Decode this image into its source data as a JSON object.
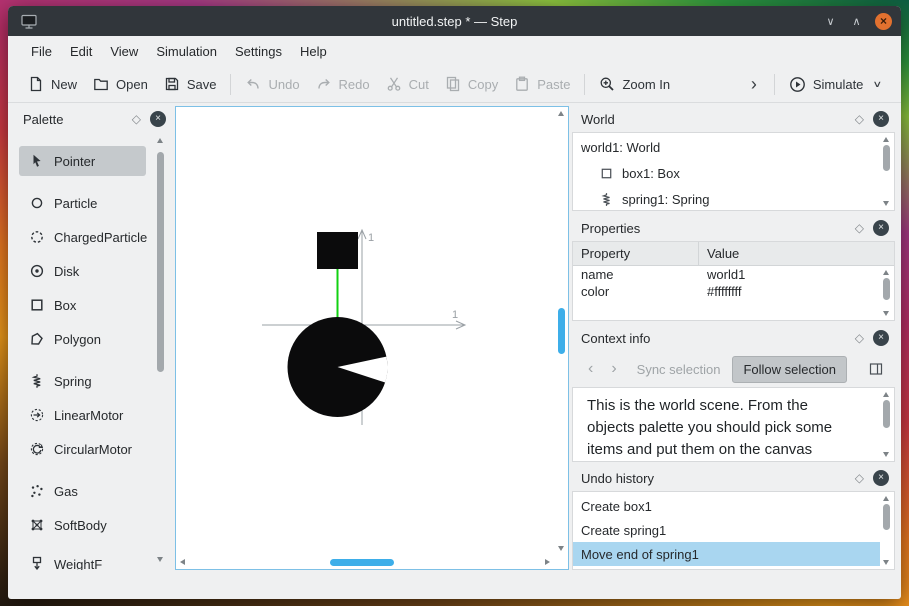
{
  "window": {
    "title": "untitled.step * — Step",
    "minimize_glyph": "∨",
    "maximize_glyph": "∧",
    "close_glyph": "×"
  },
  "menubar": {
    "items": [
      "File",
      "Edit",
      "View",
      "Simulation",
      "Settings",
      "Help"
    ]
  },
  "toolbar": {
    "new": "New",
    "open": "Open",
    "save": "Save",
    "undo": "Undo",
    "redo": "Redo",
    "cut": "Cut",
    "copy": "Copy",
    "paste": "Paste",
    "zoom_in": "Zoom In",
    "overflow_glyph": "›",
    "simulate": "Simulate",
    "simulate_caret": "∨"
  },
  "panel_controls": {
    "float_glyph": "◇",
    "close_glyph": "×"
  },
  "palette": {
    "title": "Palette",
    "items": [
      {
        "label": "Pointer",
        "icon": "pointer-icon",
        "selected": true
      },
      {
        "label": "Particle",
        "icon": "particle-icon",
        "selected": false
      },
      {
        "label": "ChargedParticle",
        "icon": "charged-particle-icon",
        "selected": false
      },
      {
        "label": "Disk",
        "icon": "disk-icon",
        "selected": false
      },
      {
        "label": "Box",
        "icon": "box-icon",
        "selected": false
      },
      {
        "label": "Polygon",
        "icon": "polygon-icon",
        "selected": false
      },
      {
        "label": "Spring",
        "icon": "spring-icon",
        "selected": false
      },
      {
        "label": "LinearMotor",
        "icon": "linear-motor-icon",
        "selected": false
      },
      {
        "label": "CircularMotor",
        "icon": "circular-motor-icon",
        "selected": false
      },
      {
        "label": "Gas",
        "icon": "gas-icon",
        "selected": false
      },
      {
        "label": "SoftBody",
        "icon": "softbody-icon",
        "selected": false
      },
      {
        "label": "WeightF",
        "icon": "weight-icon",
        "selected": false
      }
    ]
  },
  "canvas": {
    "x_axis_label": "1",
    "y_axis_label": "1",
    "objects": [
      {
        "name": "box1",
        "shape": "box",
        "color": "#000000"
      },
      {
        "name": "spring1",
        "shape": "spring",
        "color": "#12d112"
      },
      {
        "name": "disk",
        "shape": "disk-with-wedge",
        "color": "#000000"
      }
    ]
  },
  "world_panel": {
    "title": "World",
    "tree": [
      {
        "label": "world1: World",
        "level": 0
      },
      {
        "label": "box1: Box",
        "level": 1,
        "icon": "box-icon"
      },
      {
        "label": "spring1: Spring",
        "level": 1,
        "icon": "spring-icon"
      }
    ]
  },
  "properties_panel": {
    "title": "Properties",
    "columns": {
      "property": "Property",
      "value": "Value"
    },
    "rows": [
      {
        "property": "name",
        "value": "world1"
      },
      {
        "property": "color",
        "value": "#ffffffff"
      }
    ]
  },
  "context_panel": {
    "title": "Context info",
    "nav_back_glyph": "‹",
    "nav_forward_glyph": "›",
    "sync_label": "Sync selection",
    "follow_label": "Follow selection",
    "lines": [
      "This is the world scene. From the",
      "objects palette you should pick some",
      "items and put them on the canvas"
    ]
  },
  "undo_panel": {
    "title": "Undo history",
    "items": [
      {
        "label": "Create box1",
        "selected": false
      },
      {
        "label": "Create spring1",
        "selected": false
      },
      {
        "label": "Move end of spring1",
        "selected": true
      }
    ]
  },
  "colors": {
    "accent": "#3daee9",
    "selection": "#a9d6f0",
    "titlebar": "#31363b",
    "window_background": "#eff0f1",
    "canvas_focus_border": "#7dc0e6",
    "spring_green": "#12d112",
    "close_button_orange": "#e2712f"
  }
}
